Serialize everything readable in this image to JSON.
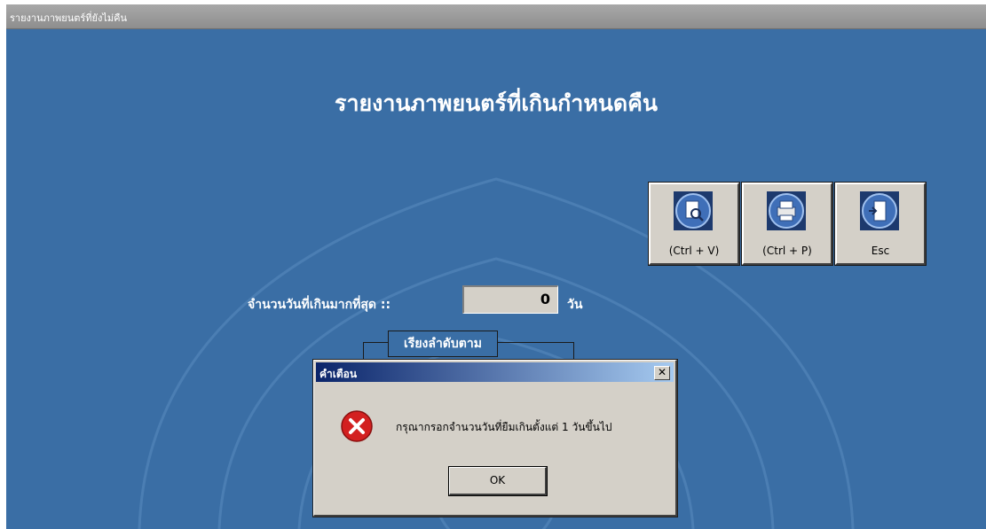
{
  "window": {
    "title": "รายงานภาพยนตร์ที่ยังไม่คืน"
  },
  "main": {
    "heading": "รายงานภาพยนตร์ที่เกินกำหนดคืน",
    "days_label": "จำนวนวันที่เกินมากที่สุด ::",
    "days_value": "0",
    "days_unit": "วัน",
    "sort_group_title": "เรียงลำดับตาม"
  },
  "toolbar": {
    "buttons": [
      {
        "label": "(Ctrl + V)",
        "icon": "preview-icon"
      },
      {
        "label": "(Ctrl + P)",
        "icon": "printer-icon"
      },
      {
        "label": "Esc",
        "icon": "exit-door-icon"
      }
    ]
  },
  "dialog": {
    "title": "คำเตือน",
    "close_glyph": "✕",
    "icon": "error-icon",
    "message": "กรุณากรอกจำนวนวันที่ยืมเกินตั้งแต่ 1 วันขึ้นไป",
    "ok_label": "OK"
  },
  "colors": {
    "background": "#3a6ea5",
    "dialog_face": "#d4d0c8",
    "title_active": "#0a246a"
  }
}
